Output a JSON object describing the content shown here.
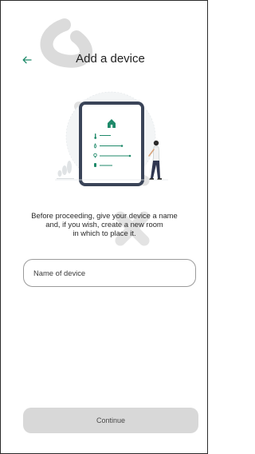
{
  "header": {
    "back_icon": "arrow-left-icon",
    "title": "Add a device"
  },
  "description": {
    "line1": "Before proceeding, give your device a name",
    "line2": "and, if you wish, create a new room",
    "line3": "in which to place it."
  },
  "form": {
    "name_placeholder": "Name of device",
    "name_value": ""
  },
  "footer": {
    "continue_label": "Continue"
  },
  "colors": {
    "accent": "#1f8a6a",
    "tablet_frame": "#3a4458",
    "button_disabled": "#d8d8d8",
    "watermark": "#c9c9c9"
  },
  "icons": {
    "house": "home-icon",
    "thermometer": "thermometer-icon",
    "humidity": "droplet-icon",
    "light": "lightbulb-icon",
    "plug": "plug-icon"
  }
}
